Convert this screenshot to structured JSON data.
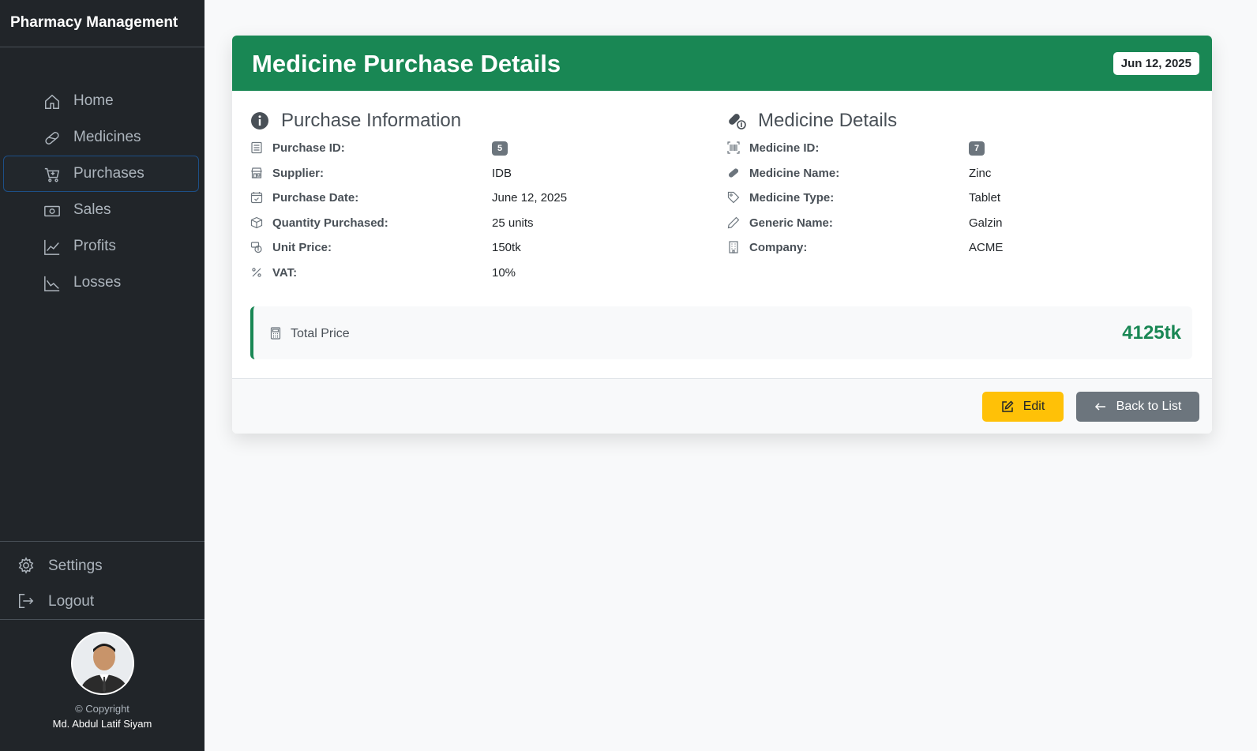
{
  "app": {
    "title": "Pharmacy Management"
  },
  "sidebar": {
    "items": [
      {
        "label": "Home",
        "icon": "home-icon"
      },
      {
        "label": "Medicines",
        "icon": "capsule-icon"
      },
      {
        "label": "Purchases",
        "icon": "cart-icon",
        "active": true
      },
      {
        "label": "Sales",
        "icon": "cash-icon"
      },
      {
        "label": "Profits",
        "icon": "graph-up-icon"
      },
      {
        "label": "Losses",
        "icon": "graph-down-icon"
      }
    ],
    "bottom_items": [
      {
        "label": "Settings",
        "icon": "gear-icon"
      },
      {
        "label": "Logout",
        "icon": "logout-icon"
      }
    ],
    "profile": {
      "copyright": "© Copyright",
      "author": "Md. Abdul Latif Siyam"
    }
  },
  "card": {
    "title": "Medicine Purchase Details",
    "date": "Jun 12, 2025",
    "purchase_info": {
      "title": "Purchase Information",
      "rows": [
        {
          "label": "Purchase ID:",
          "value": "5",
          "badge": true,
          "icon": "receipt-icon"
        },
        {
          "label": "Supplier:",
          "value": "IDB",
          "icon": "shop-icon"
        },
        {
          "label": "Purchase Date:",
          "value": "June 12, 2025",
          "icon": "calendar-check-icon"
        },
        {
          "label": "Quantity Purchased:",
          "value": "25 units",
          "icon": "box-icon"
        },
        {
          "label": "Unit Price:",
          "value": "150tk",
          "icon": "coin-icon"
        },
        {
          "label": "VAT:",
          "value": "10%",
          "icon": "percent-icon"
        }
      ]
    },
    "medicine_details": {
      "title": "Medicine Details",
      "rows": [
        {
          "label": "Medicine ID:",
          "value": "7",
          "badge": true,
          "icon": "barcode-icon"
        },
        {
          "label": "Medicine Name:",
          "value": "Zinc",
          "icon": "capsule-icon"
        },
        {
          "label": "Medicine Type:",
          "value": "Tablet",
          "icon": "tag-icon"
        },
        {
          "label": "Generic Name:",
          "value": "Galzin",
          "icon": "pen-icon"
        },
        {
          "label": "Company:",
          "value": "ACME",
          "icon": "building-icon"
        }
      ]
    },
    "total": {
      "label": "Total Price",
      "value": "4125tk"
    },
    "buttons": {
      "edit": "Edit",
      "back": "Back to List"
    }
  },
  "colors": {
    "sidebar_bg": "#212529",
    "primary_green": "#198754",
    "warning": "#ffc107",
    "secondary": "#6c757d"
  }
}
